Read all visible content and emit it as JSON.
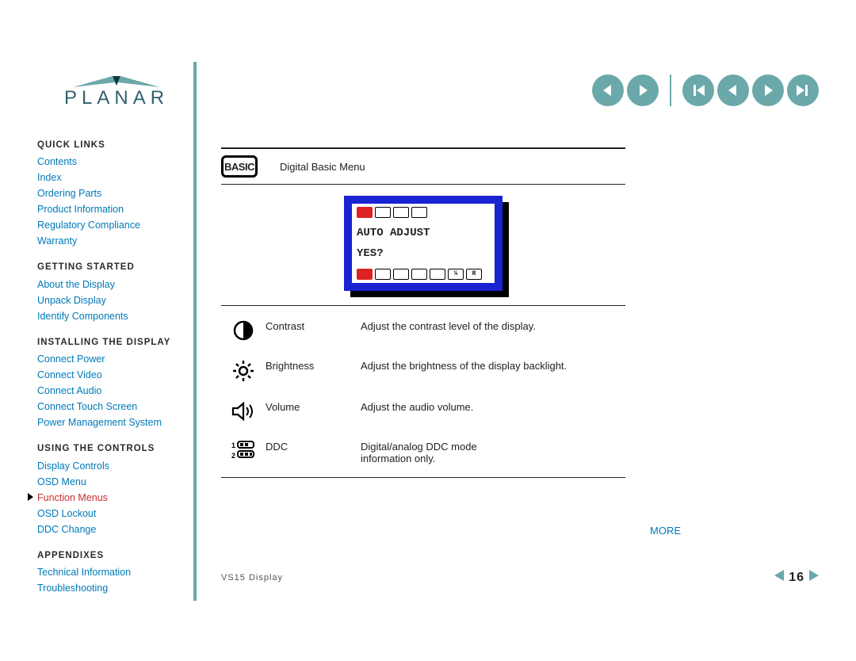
{
  "brand": "PLANAR",
  "sidebar": {
    "sections": [
      {
        "heading": "QUICK LINKS",
        "items": [
          "Contents",
          "Index",
          "Ordering Parts",
          "Product Information",
          "Regulatory Compliance",
          "Warranty"
        ]
      },
      {
        "heading": "GETTING STARTED",
        "items": [
          "About the Display",
          "Unpack Display",
          "Identify Components"
        ]
      },
      {
        "heading": "INSTALLING THE DISPLAY",
        "items": [
          "Connect Power",
          "Connect Video",
          "Connect Audio",
          "Connect Touch Screen",
          "Power Management System"
        ]
      },
      {
        "heading": "USING THE CONTROLS",
        "items": [
          "Display Controls",
          "OSD Menu",
          "Function Menus",
          "OSD Lockout",
          "DDC Change"
        ],
        "current_index": 2
      },
      {
        "heading": "APPENDIXES",
        "items": [
          "Technical Information",
          "Troubleshooting"
        ]
      }
    ]
  },
  "content": {
    "basic_badge": "BASIC",
    "section_title": "Digital Basic Menu",
    "osd": {
      "line1": "AUTO ADJUST",
      "line2": "YES?"
    },
    "features": [
      {
        "icon": "contrast-icon",
        "name": "Contrast",
        "desc": "Adjust the contrast level of the display."
      },
      {
        "icon": "brightness-icon",
        "name": "Brightness",
        "desc": "Adjust the brightness of the display backlight."
      },
      {
        "icon": "volume-icon",
        "name": "Volume",
        "desc": "Adjust the audio volume."
      },
      {
        "icon": "ddc-icon",
        "name": "DDC",
        "desc": "Digital/analog DDC mode\ninformation only."
      }
    ],
    "more_label": "MORE"
  },
  "footer": {
    "product": "VS15 Display",
    "page_number": "16"
  }
}
